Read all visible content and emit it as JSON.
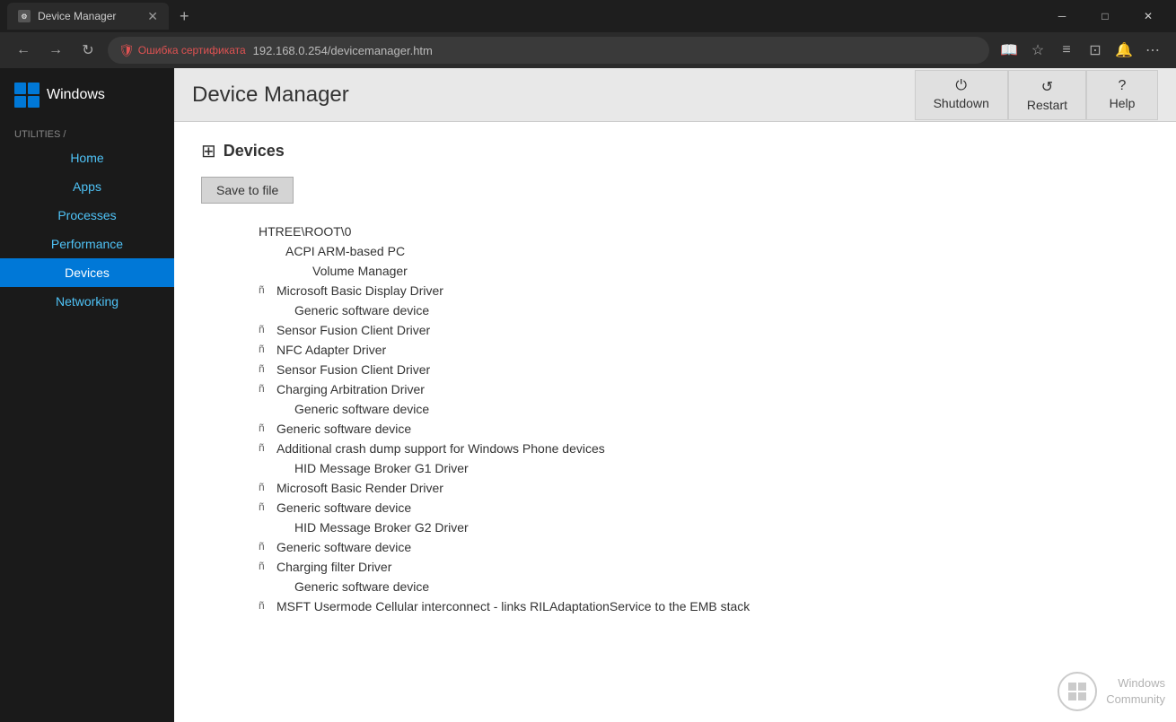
{
  "browser": {
    "tab_title": "Device Manager",
    "new_tab_title": "+",
    "window_controls": {
      "minimize": "─",
      "maximize": "□",
      "close": "✕"
    },
    "nav": {
      "back": "←",
      "forward": "→",
      "refresh": "↻"
    },
    "security_error": "Ошибка сертификата",
    "url": "192.168.0.254/devicemanager.htm",
    "toolbar_icons": [
      "📖",
      "★",
      "≡",
      "⊡",
      "🔔",
      "⋯"
    ]
  },
  "sidebar": {
    "brand": "Windows",
    "utilities_label": "UTILITIES /",
    "nav_items": [
      {
        "label": "Home",
        "active": false
      },
      {
        "label": "Apps",
        "active": false
      },
      {
        "label": "Processes",
        "active": false
      },
      {
        "label": "Performance",
        "active": false
      },
      {
        "label": "Devices",
        "active": true
      },
      {
        "label": "Networking",
        "active": false
      }
    ]
  },
  "header": {
    "title": "Device Manager",
    "buttons": [
      {
        "label": "Shutdown",
        "icon": "⏻"
      },
      {
        "label": "Restart",
        "icon": "↺"
      },
      {
        "label": "Help",
        "icon": "?"
      }
    ]
  },
  "devices": {
    "section_title": "Devices",
    "save_button": "Save to file",
    "tree": [
      {
        "indent": 0,
        "icon": false,
        "name": "HTREE\\ROOT\\0"
      },
      {
        "indent": 1,
        "icon": false,
        "name": "ACPI ARM-based PC"
      },
      {
        "indent": 2,
        "icon": false,
        "name": "Volume Manager"
      },
      {
        "indent": 1,
        "icon": true,
        "name": "Microsoft Basic Display Driver"
      },
      {
        "indent": 2,
        "icon": false,
        "name": "Generic software device"
      },
      {
        "indent": 1,
        "icon": true,
        "name": "Sensor Fusion Client Driver"
      },
      {
        "indent": 1,
        "icon": true,
        "name": "NFC Adapter Driver"
      },
      {
        "indent": 1,
        "icon": true,
        "name": "Sensor Fusion Client Driver"
      },
      {
        "indent": 1,
        "icon": true,
        "name": "Charging Arbitration Driver"
      },
      {
        "indent": 2,
        "icon": false,
        "name": "Generic software device"
      },
      {
        "indent": 1,
        "icon": true,
        "name": "Generic software device"
      },
      {
        "indent": 1,
        "icon": true,
        "name": "Additional crash dump support for Windows Phone devices"
      },
      {
        "indent": 2,
        "icon": false,
        "name": "HID Message Broker G1 Driver"
      },
      {
        "indent": 1,
        "icon": true,
        "name": "Microsoft Basic Render Driver"
      },
      {
        "indent": 1,
        "icon": true,
        "name": "Generic software device"
      },
      {
        "indent": 2,
        "icon": false,
        "name": "HID Message Broker G2 Driver"
      },
      {
        "indent": 1,
        "icon": true,
        "name": "Generic software device"
      },
      {
        "indent": 1,
        "icon": true,
        "name": "Charging filter Driver"
      },
      {
        "indent": 2,
        "icon": false,
        "name": "Generic software device"
      },
      {
        "indent": 1,
        "icon": true,
        "name": "MSFT Usermode Cellular interconnect - links RILAdaptationService to the EMB stack"
      }
    ]
  },
  "watermark": {
    "text_line1": "Windows",
    "text_line2": "Community"
  }
}
